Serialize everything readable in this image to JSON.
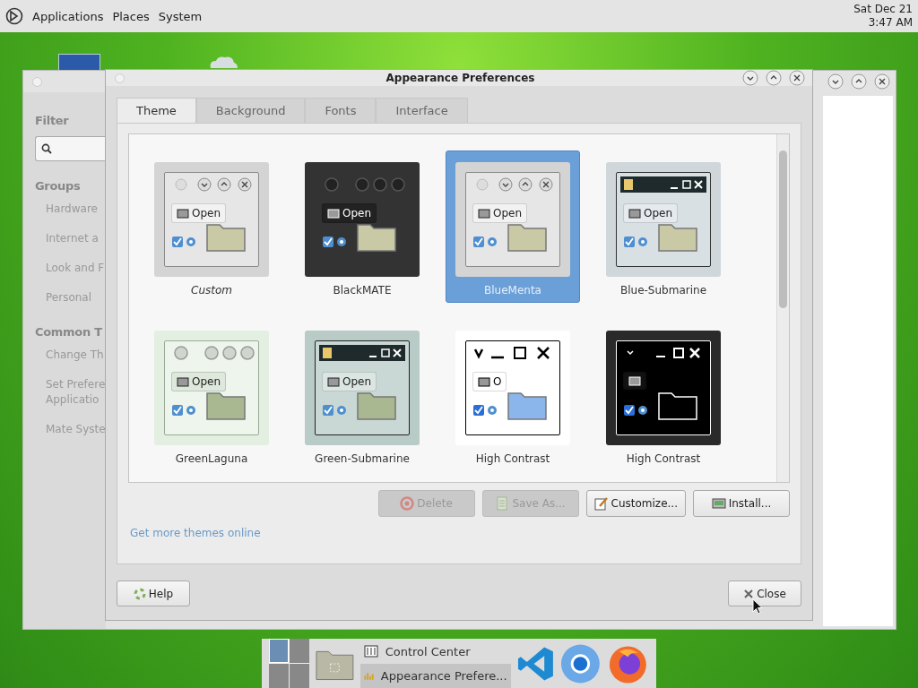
{
  "top_panel": {
    "menus": [
      "Applications",
      "Places",
      "System"
    ],
    "clock": {
      "date": "Sat Dec 21",
      "time": "3:47 AM"
    }
  },
  "background_window": {
    "filter_heading": "Filter",
    "groups_heading": "Groups",
    "groups": [
      "Hardware",
      "Internet a",
      "Look and F",
      "Personal"
    ],
    "common_heading": "Common T",
    "common": [
      "Change Th",
      "Set Prefere\nApplicatio",
      "Mate Syste"
    ]
  },
  "dialog": {
    "title": "Appearance Preferences",
    "tabs": [
      {
        "label": "Theme",
        "selected": true
      },
      {
        "label": "Background",
        "selected": false
      },
      {
        "label": "Fonts",
        "selected": false
      },
      {
        "label": "Interface",
        "selected": false
      }
    ],
    "themes": [
      {
        "name": "Custom",
        "kind": "light",
        "open_label": "Open",
        "italic": true,
        "selected": false
      },
      {
        "name": "BlackMATE",
        "kind": "dark",
        "open_label": "Open",
        "italic": false,
        "selected": false
      },
      {
        "name": "BlueMenta",
        "kind": "light",
        "open_label": "Open",
        "italic": false,
        "selected": true
      },
      {
        "name": "Blue-Submarine",
        "kind": "blue-sub",
        "open_label": "Open",
        "italic": false,
        "selected": false
      },
      {
        "name": "GreenLaguna",
        "kind": "laguna",
        "open_label": "Open",
        "italic": false,
        "selected": false
      },
      {
        "name": "Green-Submarine",
        "kind": "green-sub",
        "open_label": "Open",
        "italic": false,
        "selected": false
      },
      {
        "name": "High Contrast",
        "kind": "hc",
        "open_label": "O",
        "italic": false,
        "selected": false
      },
      {
        "name": "High Contrast",
        "kind": "hc-inverse",
        "italic": false,
        "selected": false
      }
    ],
    "actions": [
      {
        "label": "Delete",
        "kind": "delete",
        "disabled": true
      },
      {
        "label": "Save As...",
        "kind": "save",
        "disabled": true
      },
      {
        "label": "Customize...",
        "kind": "customize",
        "disabled": false
      },
      {
        "label": "Install...",
        "kind": "install",
        "disabled": false
      }
    ],
    "link": "Get more themes online",
    "help_button": "Help",
    "close_button": "Close"
  },
  "taskbar": {
    "tasks": [
      {
        "label": "Control Center",
        "selected": false
      },
      {
        "label": "Appearance Prefere...",
        "selected": true
      }
    ]
  }
}
